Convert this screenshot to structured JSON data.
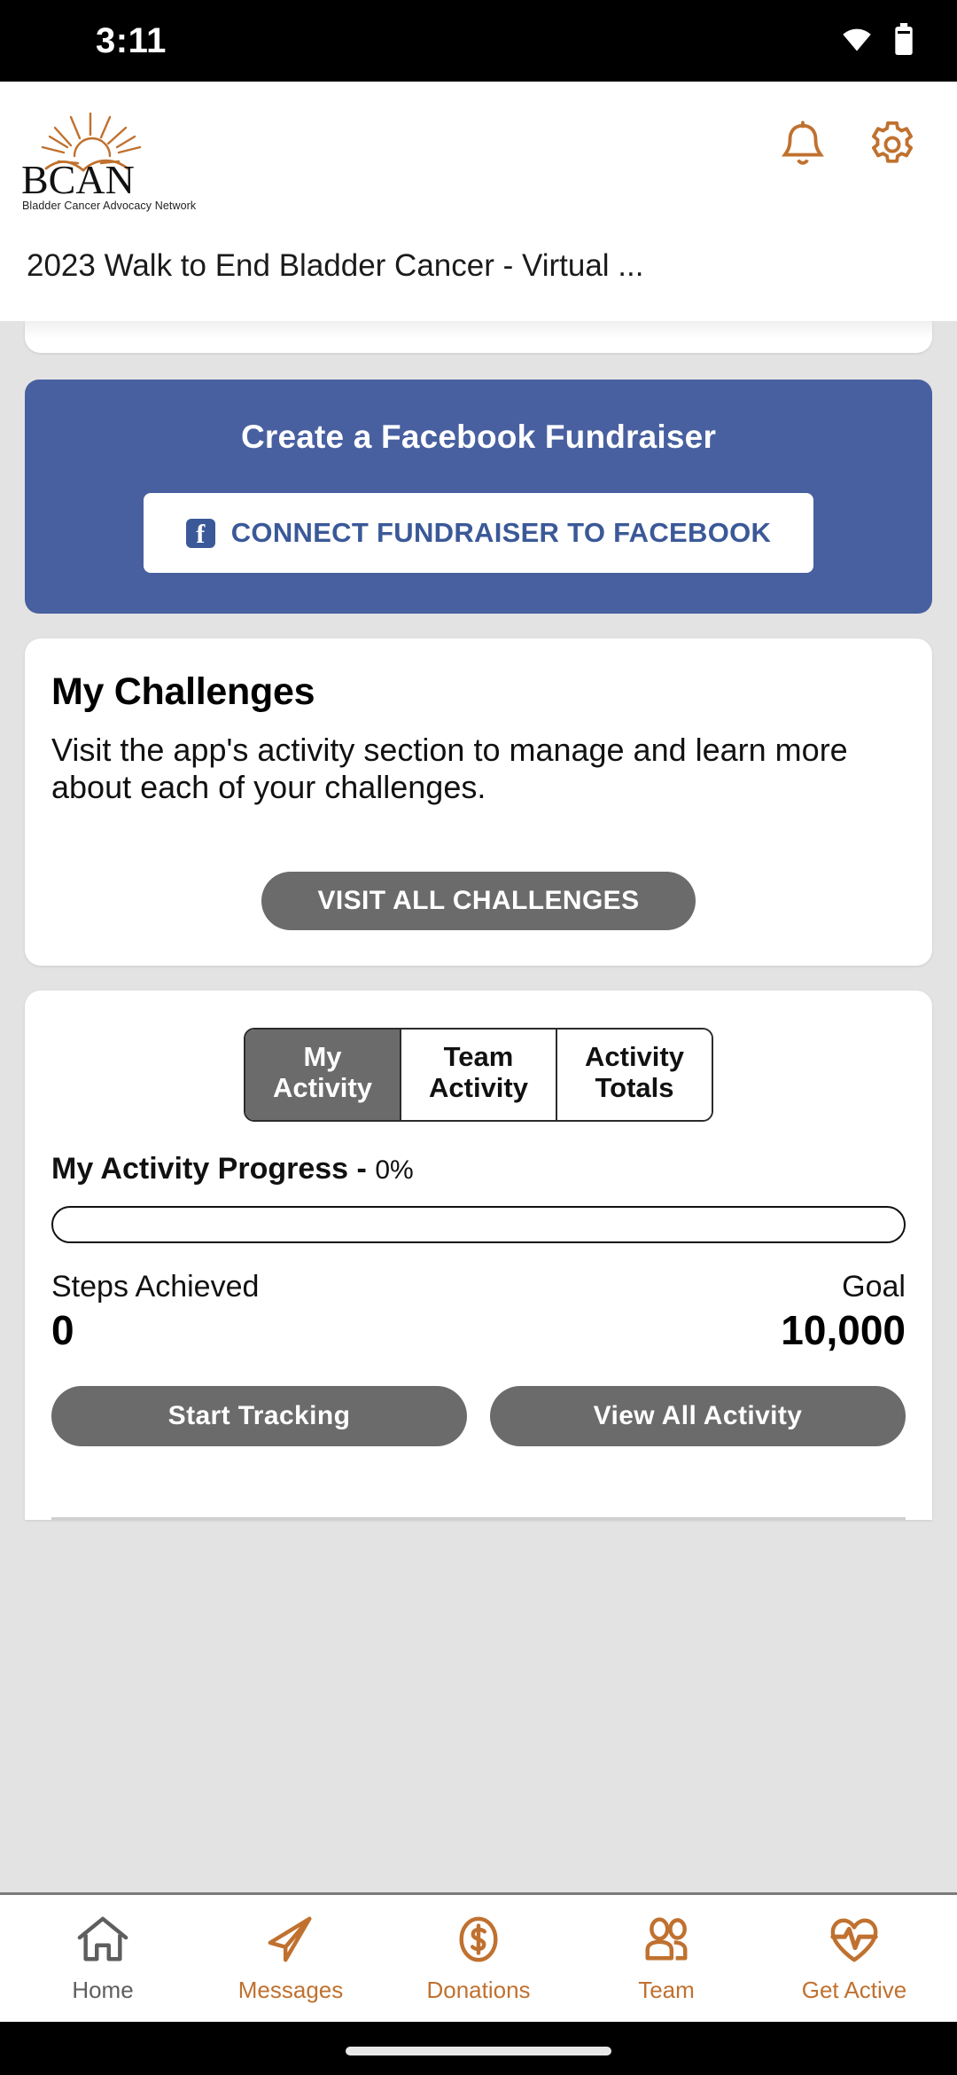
{
  "status_bar": {
    "time": "3:11",
    "icons": [
      "wifi-icon",
      "battery-icon"
    ]
  },
  "header": {
    "logo_text": "BCAN",
    "logo_subtitle": "Bladder Cancer Advocacy Network",
    "event_title": "2023 Walk to End Bladder Cancer - Virtual ...",
    "notification_icon": "bell-icon",
    "settings_icon": "gear-icon",
    "accent_color": "#c0712f"
  },
  "facebook_card": {
    "title": "Create a Facebook Fundraiser",
    "button_label": "CONNECT FUNDRAISER TO FACEBOOK",
    "button_icon": "facebook-icon",
    "background_color": "#4860a0",
    "button_text_color": "#3b5998"
  },
  "challenges_card": {
    "title": "My Challenges",
    "body": "Visit the app's activity section to manage and learn more about each of your challenges.",
    "button_label": "VISIT ALL CHALLENGES"
  },
  "activity_card": {
    "tabs": [
      {
        "label_line1": "My",
        "label_line2": "Activity",
        "active": true
      },
      {
        "label_line1": "Team",
        "label_line2": "Activity",
        "active": false
      },
      {
        "label_line1": "Activity",
        "label_line2": "Totals",
        "active": false
      }
    ],
    "progress_title": "My Activity Progress - ",
    "progress_percent": "0%",
    "progress_value": 0,
    "stats": {
      "achieved_label": "Steps Achieved",
      "achieved_value": "0",
      "goal_label": "Goal",
      "goal_value": "10,000"
    },
    "start_tracking_label": "Start Tracking",
    "view_all_label": "View All Activity",
    "button_color": "#6b6b6b"
  },
  "bottom_nav": {
    "items": [
      {
        "label": "Home",
        "icon": "home-icon",
        "active": true
      },
      {
        "label": "Messages",
        "icon": "paper-plane-icon",
        "active": false
      },
      {
        "label": "Donations",
        "icon": "dollar-circle-icon",
        "active": false
      },
      {
        "label": "Team",
        "icon": "people-icon",
        "active": false
      },
      {
        "label": "Get Active",
        "icon": "heart-pulse-icon",
        "active": false
      }
    ],
    "active_color": "#5e5e5e",
    "inactive_color": "#c0712f"
  }
}
